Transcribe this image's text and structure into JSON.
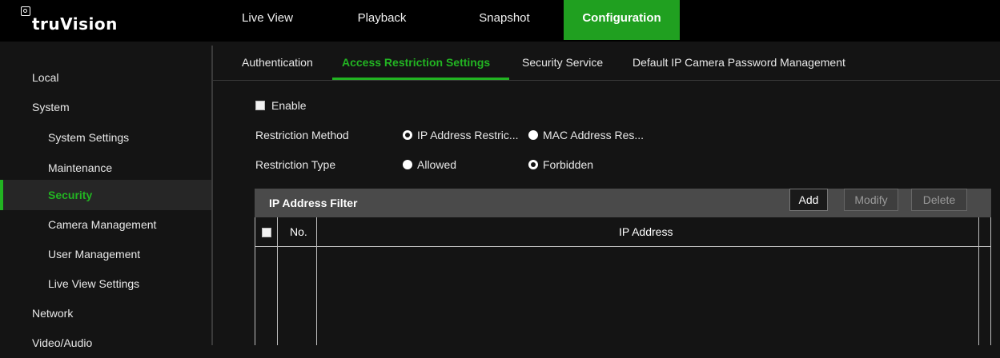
{
  "app": {
    "logo_text": "truVision"
  },
  "nav": [
    {
      "label": "Live View",
      "active": false
    },
    {
      "label": "Playback",
      "active": false
    },
    {
      "label": "Snapshot",
      "active": false
    },
    {
      "label": "Configuration",
      "active": true
    }
  ],
  "sidebar": {
    "items": [
      {
        "label": "Local",
        "level": "top"
      },
      {
        "label": "System",
        "level": "top"
      },
      {
        "label": "System Settings",
        "level": "sub"
      },
      {
        "label": "Maintenance",
        "level": "sub"
      },
      {
        "label": "Security",
        "level": "sub",
        "active": true
      },
      {
        "label": "Camera Management",
        "level": "sub"
      },
      {
        "label": "User Management",
        "level": "sub"
      },
      {
        "label": "Live View Settings",
        "level": "sub"
      },
      {
        "label": "Network",
        "level": "top"
      },
      {
        "label": "Video/Audio",
        "level": "top"
      }
    ]
  },
  "tabs": [
    {
      "label": "Authentication"
    },
    {
      "label": "Access Restriction Settings",
      "active": true
    },
    {
      "label": "Security Service"
    },
    {
      "label": "Default IP Camera Password Management"
    }
  ],
  "form": {
    "enable_label": "Enable",
    "enable_checked": true,
    "method_label": "Restriction Method",
    "method_options": [
      {
        "label": "IP Address Restric...",
        "selected": true
      },
      {
        "label": "MAC Address Res...",
        "selected": false
      }
    ],
    "type_label": "Restriction Type",
    "type_options": [
      {
        "label": "Allowed",
        "selected": false
      },
      {
        "label": "Forbidden",
        "selected": true
      }
    ]
  },
  "filter": {
    "title": "IP Address Filter",
    "buttons": [
      {
        "label": "Add",
        "enabled": true
      },
      {
        "label": "Modify",
        "enabled": false
      },
      {
        "label": "Delete",
        "enabled": false
      }
    ],
    "columns": {
      "no": "No.",
      "ip": "IP Address"
    },
    "rows": []
  },
  "colors": {
    "accent": "#22b422",
    "nav_active": "#20a020",
    "background": "#141414",
    "header_bar": "#4a4a4a"
  }
}
